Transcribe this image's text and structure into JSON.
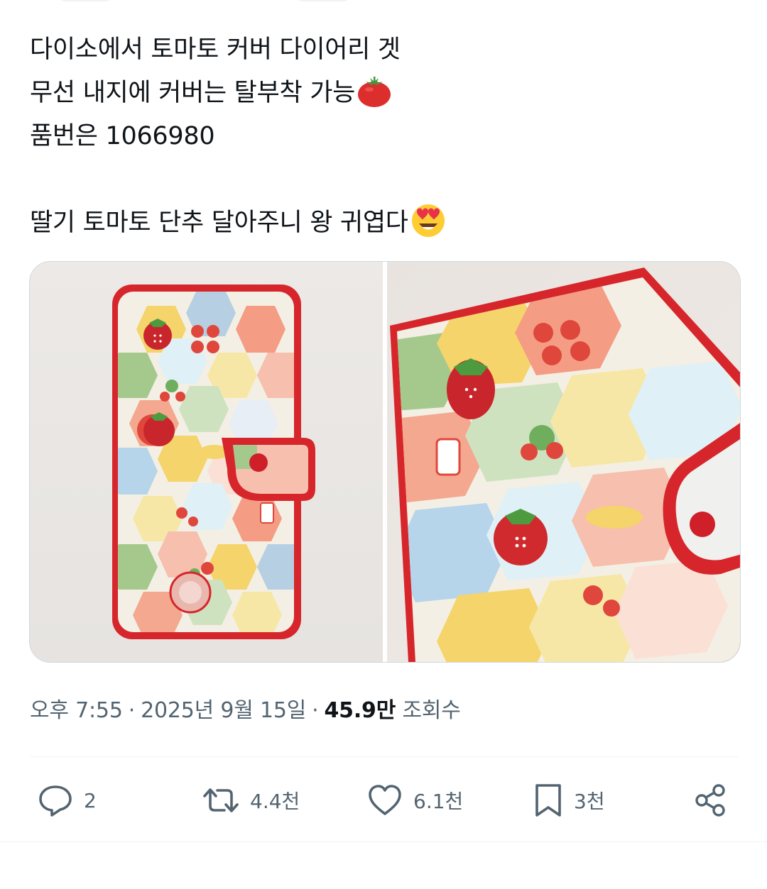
{
  "tweet": {
    "lines": [
      "다이소에서 토마토 커버 다이어리 겟",
      "무선 내지에 커버는 탈부착 가능",
      "품번은 1066980",
      "딸기 토마토 단추 달아주니 왕 귀엽다"
    ]
  },
  "emojis": {
    "tomato": "tomato-emoji",
    "heart_eyes": "smiling-face-with-heart-eyes-emoji"
  },
  "meta": {
    "time": "오후 7:55",
    "date": "2025년 9월 15일",
    "views_count": "45.9만",
    "views_label": "조회수"
  },
  "actions": {
    "replies": "2",
    "reposts": "4.4천",
    "likes": "6.1천",
    "bookmarks": "3천"
  },
  "colors": {
    "text": "#0f1419",
    "secondary": "#536471",
    "divider": "#eff3f4",
    "cover_red": "#d8272c"
  }
}
